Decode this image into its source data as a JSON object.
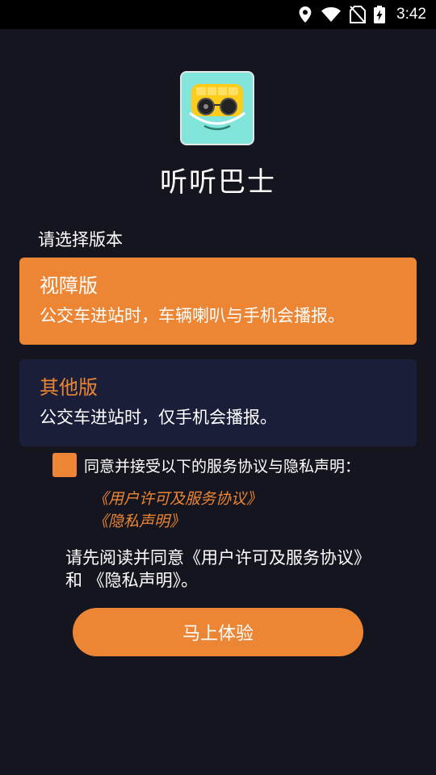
{
  "status_bar": {
    "time": "3:42",
    "icons": [
      "location-icon",
      "wifi-icon",
      "no-sim-icon",
      "battery-charging-icon"
    ]
  },
  "app": {
    "title": "听听巴士",
    "icon": "bus-face-logo-icon"
  },
  "select_label": "请选择版本",
  "versions": [
    {
      "title": "视障版",
      "description": "公交车进站时，车辆喇叭与手机会播报。",
      "selected": true
    },
    {
      "title": "其他版",
      "description": "公交车进站时，仅手机会播报。",
      "selected": false
    }
  ],
  "agreement": {
    "checkbox_label": "同意并接受以下的服务协议与隐私声明：",
    "link_agreement": "《用户许可及服务协议》",
    "link_privacy": "《隐私声明》"
  },
  "notice": "请先阅读并同意《用户许可及服务协议》和 《隐私声明》。",
  "start_button": "马上体验",
  "colors": {
    "background": "#15151f",
    "accent": "#ec8534",
    "card_unselected": "#1b1e38"
  }
}
